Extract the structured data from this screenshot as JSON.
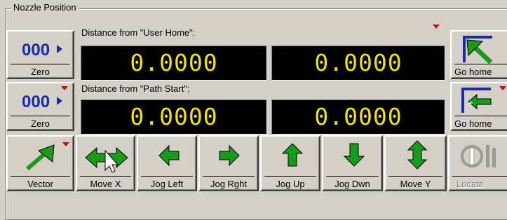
{
  "group": {
    "title": "Nozzle Position"
  },
  "user_home": {
    "label": "Distance from \"User Home\":",
    "x_value": "0.0000",
    "y_value": "0.0000",
    "zero_label": "Zero",
    "zero_icon_text": "000",
    "go_home_label": "Go home"
  },
  "path_start": {
    "label": "Distance from \"Path Start\":",
    "x_value": "0.0000",
    "y_value": "0.0000",
    "zero_label": "Zero",
    "zero_icon_text": "000",
    "go_home_label": "Go home"
  },
  "toolbar": {
    "vector": "Vector",
    "move_x": "Move X",
    "jog_left": "Jog Left",
    "jog_right": "Jog Rght",
    "jog_up": "Jog Up",
    "jog_down": "Jog Dwn",
    "move_y": "Move Y",
    "locate": "Locate"
  },
  "colors": {
    "display_bg": "#000000",
    "display_text": "#f2e400",
    "arrow_green": "#1a9a1a",
    "icon_blue": "#1a2aa8",
    "marker_red": "#e00000"
  }
}
